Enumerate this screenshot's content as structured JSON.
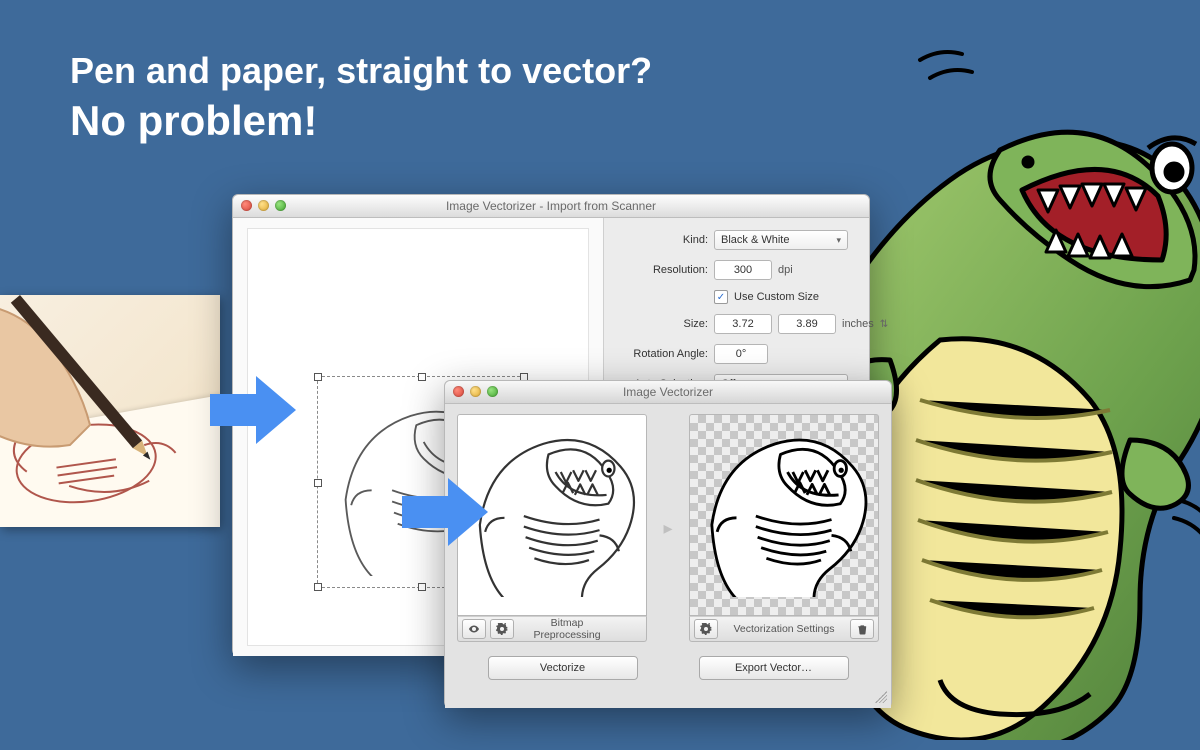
{
  "hero": {
    "line1": "Pen and paper, straight to vector?",
    "line2": "No problem!"
  },
  "scannerWindow": {
    "title": "Image Vectorizer - Import from Scanner",
    "form": {
      "kind_label": "Kind:",
      "kind_value": "Black & White",
      "resolution_label": "Resolution:",
      "resolution_value": "300",
      "resolution_unit": "dpi",
      "custom_size_label": "Use Custom Size",
      "custom_size_checked": true,
      "size_label": "Size:",
      "size_w": "3.72",
      "size_h": "3.89",
      "size_unit": "inches",
      "rotation_label": "Rotation Angle:",
      "rotation_value": "0°",
      "auto_selection_label": "Auto Selection:",
      "auto_selection_value": "Off"
    }
  },
  "vectorWindow": {
    "title": "Image Vectorizer",
    "left_bar_title": "Bitmap Preprocessing",
    "right_bar_title": "Vectorization Settings",
    "vectorize_label": "Vectorize",
    "export_label": "Export Vector…",
    "eye_icon": "eye-icon",
    "gear_icon": "gear-icon",
    "trash_icon": "trash-icon"
  }
}
